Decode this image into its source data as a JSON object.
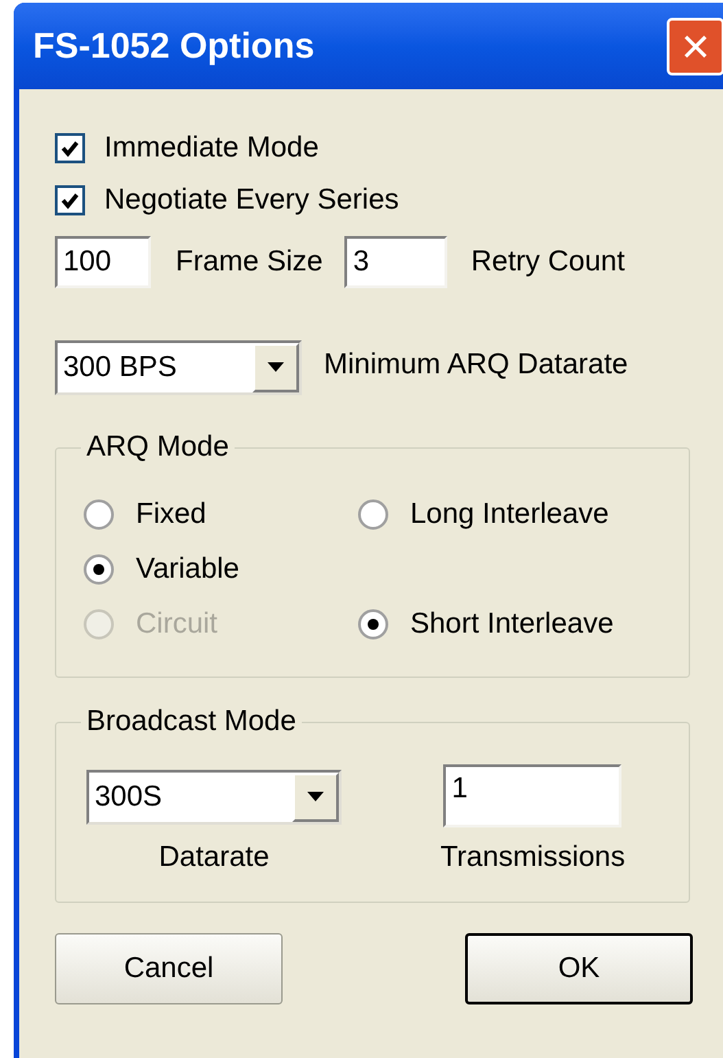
{
  "window": {
    "title": "FS-1052 Options",
    "close": "×"
  },
  "checkboxes": [
    {
      "label": "Immediate Mode",
      "checked": true
    },
    {
      "label": "Negotiate Every Series",
      "checked": true
    }
  ],
  "frame_size": {
    "value": "100",
    "label": "Frame Size"
  },
  "retry_count": {
    "value": "3",
    "label": "Retry Count"
  },
  "min_datarate": {
    "value": "300 BPS",
    "label": "Minimum ARQ Datarate"
  },
  "arq_mode": {
    "title": "ARQ Mode",
    "rows": [
      [
        {
          "label": "Fixed",
          "selected": false,
          "disabled": false
        },
        {
          "label": "Long Interleave",
          "selected": false,
          "disabled": false
        }
      ],
      [
        {
          "label": "Variable",
          "selected": true,
          "disabled": false
        }
      ],
      [
        {
          "label": "Circuit",
          "selected": false,
          "disabled": true
        },
        {
          "label": "Short Interleave",
          "selected": true,
          "disabled": false
        }
      ]
    ]
  },
  "broadcast_mode": {
    "title": "Broadcast Mode",
    "datarate": {
      "value": "300S",
      "label": "Datarate"
    },
    "transmissions": {
      "value": "1",
      "label": "Transmissions"
    }
  },
  "buttons": [
    {
      "label": "Cancel",
      "default": false
    },
    {
      "label": "OK",
      "default": true
    }
  ]
}
